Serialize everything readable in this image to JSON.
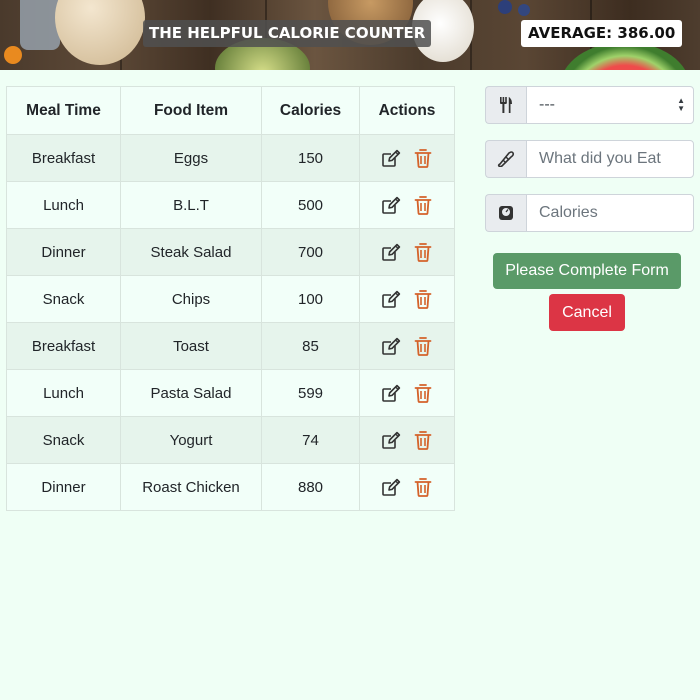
{
  "header": {
    "title": "THE HELPFUL CALORIE COUNTER",
    "average": "AVERAGE: 386.00"
  },
  "table": {
    "columns": [
      "Meal Time",
      "Food Item",
      "Calories",
      "Actions"
    ],
    "rows": [
      {
        "meal": "Breakfast",
        "food": "Eggs",
        "calories": "150"
      },
      {
        "meal": "Lunch",
        "food": "B.L.T",
        "calories": "500"
      },
      {
        "meal": "Dinner",
        "food": "Steak Salad",
        "calories": "700"
      },
      {
        "meal": "Snack",
        "food": "Chips",
        "calories": "100"
      },
      {
        "meal": "Breakfast",
        "food": "Toast",
        "calories": "85"
      },
      {
        "meal": "Lunch",
        "food": "Pasta Salad",
        "calories": "599"
      },
      {
        "meal": "Snack",
        "food": "Yogurt",
        "calories": "74"
      },
      {
        "meal": "Dinner",
        "food": "Roast Chicken",
        "calories": "880"
      }
    ]
  },
  "form": {
    "meal_select_value": "---",
    "food_placeholder": "What did you Eat",
    "calories_placeholder": "Calories",
    "submit_label": "Please Complete Form",
    "cancel_label": "Cancel"
  },
  "colors": {
    "background": "#effff5",
    "edit_icon": "#333333",
    "delete_icon": "#d4622a",
    "submit_button": "#5a9a68",
    "cancel_button": "#dc3545"
  },
  "icons": {
    "meal": "utensils-icon",
    "food": "food-icon",
    "calories": "scale-icon",
    "edit": "edit-icon",
    "delete": "trash-icon"
  }
}
